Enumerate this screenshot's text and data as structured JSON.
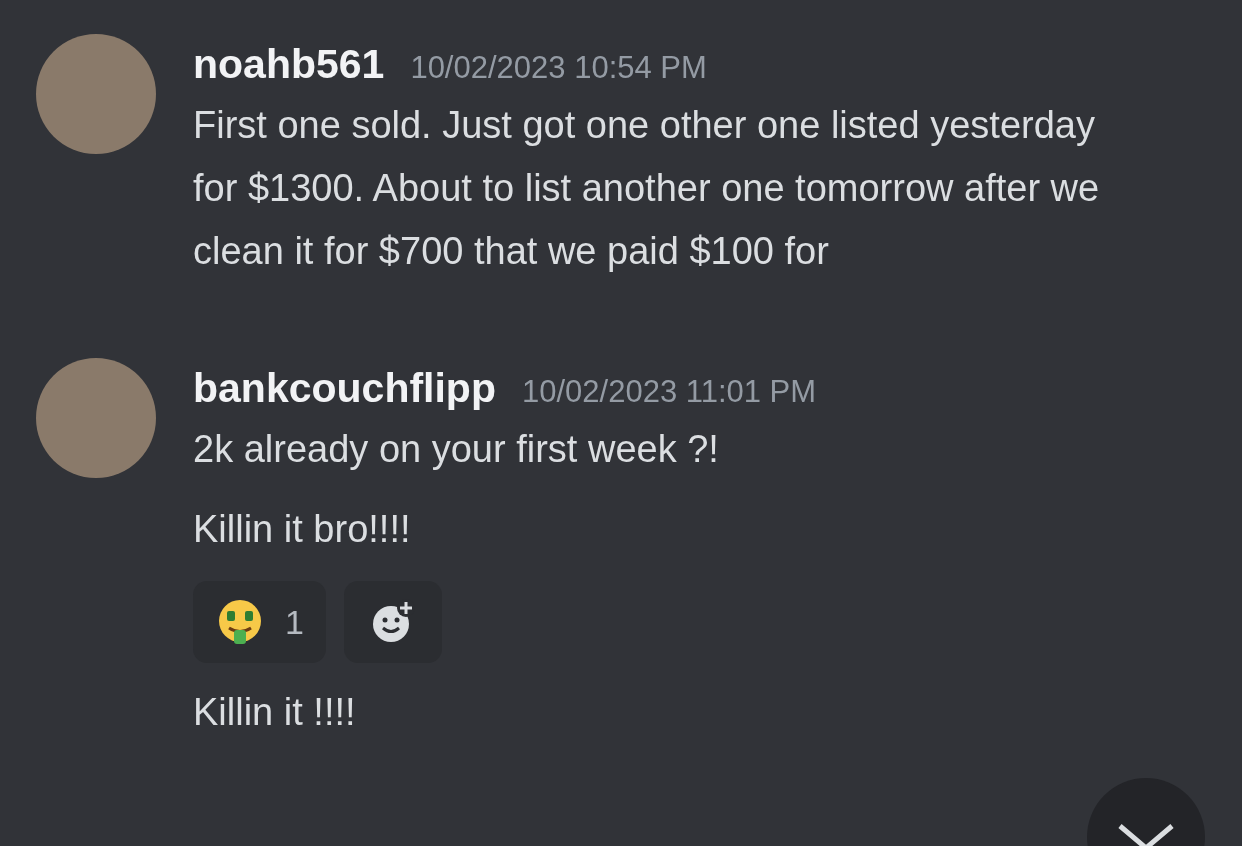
{
  "messages": [
    {
      "username": "noahb561",
      "timestamp": "10/02/2023 10:54 PM",
      "lines": [
        "First one sold. Just got one other one listed yesterday for $1300. About to list another one tomorrow after we clean it for $700 that we paid $100 for"
      ]
    },
    {
      "username": "bankcouchflipp",
      "timestamp": "10/02/2023 11:01 PM",
      "lines": [
        "2k already on your first week ?!",
        "Killin it bro!!!!"
      ],
      "reactions": [
        {
          "count": "1",
          "selected": false
        }
      ],
      "after": [
        "Killin it !!!!"
      ]
    }
  ]
}
